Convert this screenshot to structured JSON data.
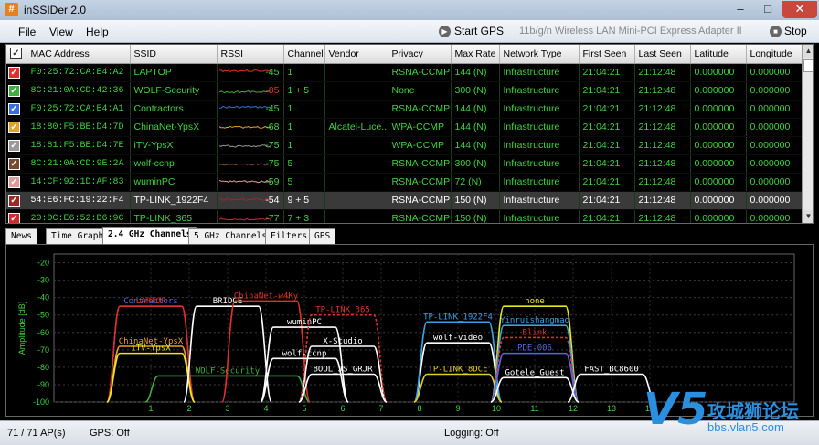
{
  "window": {
    "title": "inSSIDer 2.0",
    "icon": "#"
  },
  "menu": [
    "File",
    "View",
    "Help"
  ],
  "toolbar": {
    "start_gps": "Start GPS",
    "adapter": "11b/g/n  Wireless LAN Mini-PCI Express Adapter II",
    "stop": "Stop"
  },
  "grid": {
    "columns": [
      "MAC Address",
      "SSID",
      "RSSI",
      "Channel",
      "Vendor",
      "Privacy",
      "Max Rate",
      "Network Type",
      "First Seen",
      "Last Seen",
      "Latitude",
      "Longitude"
    ],
    "rows": [
      {
        "color": "#e0302a",
        "mac": "F0:25:72:CA:E4:A2",
        "ssid": "LAPTOP",
        "rssi": "-45",
        "channel": "1",
        "vendor": "",
        "privacy": "RSNA-CCMP",
        "rate": "144 (N)",
        "type": "Infrastructure",
        "first": "21:04:21",
        "last": "21:12:48",
        "lat": "0.000000",
        "lon": "0.000000"
      },
      {
        "color": "#3fae3f",
        "mac": "8C:21:0A:CD:42:36",
        "ssid": "WOLF-Security",
        "rssi": "-85",
        "channel": "1 + 5",
        "vendor": "",
        "privacy": "None",
        "rate": "300 (N)",
        "type": "Infrastructure",
        "first": "21:04:21",
        "last": "21:12:48",
        "lat": "0.000000",
        "lon": "0.000000"
      },
      {
        "color": "#3a6ee0",
        "mac": "F0:25:72:CA:E4:A1",
        "ssid": "Contractors",
        "rssi": "-45",
        "channel": "1",
        "vendor": "",
        "privacy": "RSNA-CCMP",
        "rate": "144 (N)",
        "type": "Infrastructure",
        "first": "21:04:21",
        "last": "21:12:48",
        "lat": "0.000000",
        "lon": "0.000000"
      },
      {
        "color": "#e8a020",
        "mac": "18:80:F5:BE:D4:7D",
        "ssid": "ChinaNet-YpsX",
        "rssi": "-68",
        "channel": "1",
        "vendor": "Alcatel-Luce...",
        "privacy": "WPA-CCMP",
        "rate": "144 (N)",
        "type": "Infrastructure",
        "first": "21:04:21",
        "last": "21:12:48",
        "lat": "0.000000",
        "lon": "0.000000"
      },
      {
        "color": "#9a9a9a",
        "mac": "18:81:F5:BE:D4:7E",
        "ssid": "iTV-YpsX",
        "rssi": "-75",
        "channel": "1",
        "vendor": "",
        "privacy": "WPA-CCMP",
        "rate": "144 (N)",
        "type": "Infrastructure",
        "first": "21:04:21",
        "last": "21:12:48",
        "lat": "0.000000",
        "lon": "0.000000"
      },
      {
        "color": "#7a4a30",
        "mac": "8C:21:0A:CD:9E:2A",
        "ssid": "wolf-ccnp",
        "rssi": "-75",
        "channel": "5",
        "vendor": "",
        "privacy": "RSNA-CCMP",
        "rate": "300 (N)",
        "type": "Infrastructure",
        "first": "21:04:21",
        "last": "21:12:48",
        "lat": "0.000000",
        "lon": "0.000000"
      },
      {
        "color": "#e09a9a",
        "mac": "14:CF:92:1D:AF:83",
        "ssid": "wuminPC",
        "rssi": "-59",
        "channel": "5",
        "vendor": "",
        "privacy": "RSNA-CCMP",
        "rate": "72 (N)",
        "type": "Infrastructure",
        "first": "21:04:21",
        "last": "21:12:48",
        "lat": "0.000000",
        "lon": "0.000000"
      },
      {
        "color": "#a02828",
        "mac": "54:E6:FC:19:22:F4",
        "ssid": "TP-LINK_1922F4",
        "rssi": "-54",
        "channel": "9 + 5",
        "vendor": "",
        "privacy": "RSNA-CCMP",
        "rate": "150 (N)",
        "type": "Infrastructure",
        "first": "21:04:21",
        "last": "21:12:48",
        "lat": "0.000000",
        "lon": "0.000000",
        "selected": true
      },
      {
        "color": "#d02a2a",
        "mac": "20:DC:E6:52:D6:9C",
        "ssid": "TP-LINK_365",
        "rssi": "-77",
        "channel": "7 + 3",
        "vendor": "",
        "privacy": "RSNA-CCMP",
        "rate": "150 (N)",
        "type": "Infrastructure",
        "first": "21:04:21",
        "last": "21:12:48",
        "lat": "0.000000",
        "lon": "0.000000"
      }
    ]
  },
  "tabs": [
    "News",
    "Time Graph",
    "2.4 GHz Channels",
    "5 GHz Channels",
    "Filters",
    "GPS"
  ],
  "active_tab": 2,
  "chart_data": {
    "type": "line",
    "ylabel": "Amplitude [dB]",
    "xlabel": "",
    "x_ticks": [
      "1",
      "2",
      "3",
      "4",
      "5",
      "6",
      "7",
      "8",
      "9",
      "10",
      "11",
      "12",
      "13",
      "14"
    ],
    "y_ticks": [
      -20,
      -30,
      -40,
      -50,
      -60,
      -70,
      -80,
      -90,
      -100
    ],
    "ylim": [
      -100,
      -15
    ],
    "grid": true,
    "networks": [
      {
        "name": "Contractors",
        "channel": 1,
        "amplitude": -45,
        "color": "#5a64e6",
        "dashed": true
      },
      {
        "name": "LAPTOP",
        "channel": 1,
        "amplitude": -45,
        "color": "#e0302a"
      },
      {
        "name": "ChinaNet-YpsX",
        "channel": 1,
        "amplitude": -68,
        "color": "#e8a020"
      },
      {
        "name": "iTV-YpsX",
        "channel": 1,
        "amplitude": -72,
        "color": "#e8e820"
      },
      {
        "name": "WOLF-Security",
        "channel": 3,
        "amplitude": -85,
        "color": "#3fae3f",
        "wide": true
      },
      {
        "name": "BRIDGE",
        "channel": 3,
        "amplitude": -45,
        "color": "#ffffff"
      },
      {
        "name": "ChinaNet-w4Ky",
        "channel": 4,
        "amplitude": -42,
        "color": "#e0302a"
      },
      {
        "name": "wuminPC",
        "channel": 5,
        "amplitude": -57,
        "color": "#ffffff"
      },
      {
        "name": "X-Studio",
        "channel": 6,
        "amplitude": -68,
        "color": "#ffffff"
      },
      {
        "name": "TP-LINK_365",
        "channel": 6,
        "amplitude": -50,
        "color": "#e0302a",
        "dashed": true
      },
      {
        "name": "wolf-ccnp",
        "channel": 5,
        "amplitude": -75,
        "color": "#ffffff"
      },
      {
        "name": "BOOL_JS_GRJR",
        "channel": 6,
        "amplitude": -84,
        "color": "#ffffff"
      },
      {
        "name": "wolf-video",
        "channel": 9,
        "amplitude": -66,
        "color": "#ffffff"
      },
      {
        "name": "TP-LINK_1922F4",
        "channel": 9,
        "amplitude": -54,
        "color": "#3aa0e0"
      },
      {
        "name": "TP-LINK_8DCE",
        "channel": 9,
        "amplitude": -84,
        "color": "#e0d020"
      },
      {
        "name": "none",
        "channel": 11,
        "amplitude": -45,
        "color": "#e8e820"
      },
      {
        "name": "Yinruishangmao",
        "channel": 11,
        "amplitude": -56,
        "color": "#3aa0e0"
      },
      {
        "name": "Blink",
        "channel": 11,
        "amplitude": -63,
        "color": "#e0302a",
        "dashed": true
      },
      {
        "name": "PDE-006",
        "channel": 11,
        "amplitude": -72,
        "color": "#5a64e6"
      },
      {
        "name": "Gotele_Guest",
        "channel": 11,
        "amplitude": -86,
        "color": "#ffffff"
      },
      {
        "name": "FAST_BC8600",
        "channel": 13,
        "amplitude": -84,
        "color": "#ffffff"
      }
    ]
  },
  "status": {
    "count": "71 / 71 AP(s)",
    "gps": "GPS: Off",
    "logging": "Logging: Off"
  },
  "watermark": {
    "brand": "V5",
    "cn": "攻城狮论坛",
    "url": "bbs.vlan5.com"
  }
}
